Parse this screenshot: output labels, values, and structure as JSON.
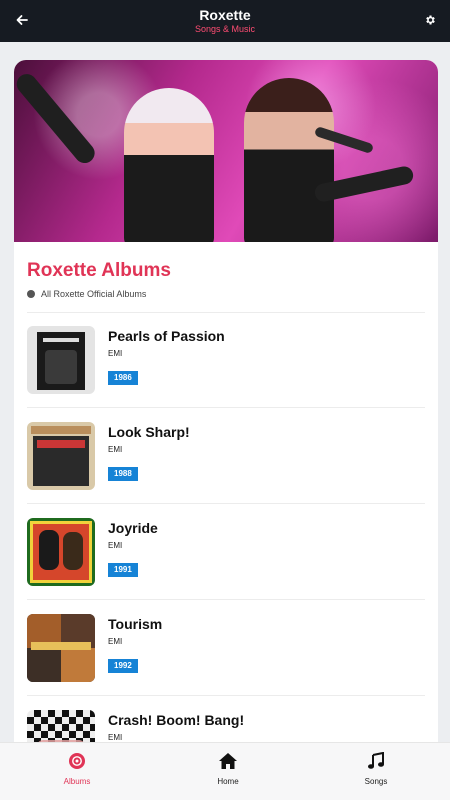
{
  "header": {
    "title": "Roxette",
    "subtitle": "Songs & Music"
  },
  "section": {
    "title": "Roxette Albums",
    "subtitle": "All Roxette Official Albums"
  },
  "albums": [
    {
      "name": "Pearls of Passion",
      "label": "EMI",
      "year": "1986"
    },
    {
      "name": "Look Sharp!",
      "label": "EMI",
      "year": "1988"
    },
    {
      "name": "Joyride",
      "label": "EMI",
      "year": "1991"
    },
    {
      "name": "Tourism",
      "label": "EMI",
      "year": "1992"
    },
    {
      "name": "Crash! Boom! Bang!",
      "label": "EMI",
      "year": ""
    }
  ],
  "nav": {
    "items": [
      {
        "label": "Albums",
        "icon": "disc-icon",
        "active": true
      },
      {
        "label": "Home",
        "icon": "home-icon",
        "active": false
      },
      {
        "label": "Songs",
        "icon": "music-note-icon",
        "active": false
      }
    ]
  },
  "colors": {
    "accent": "#e03456",
    "header_bg": "#161b22",
    "year_badge": "#1683d6"
  }
}
